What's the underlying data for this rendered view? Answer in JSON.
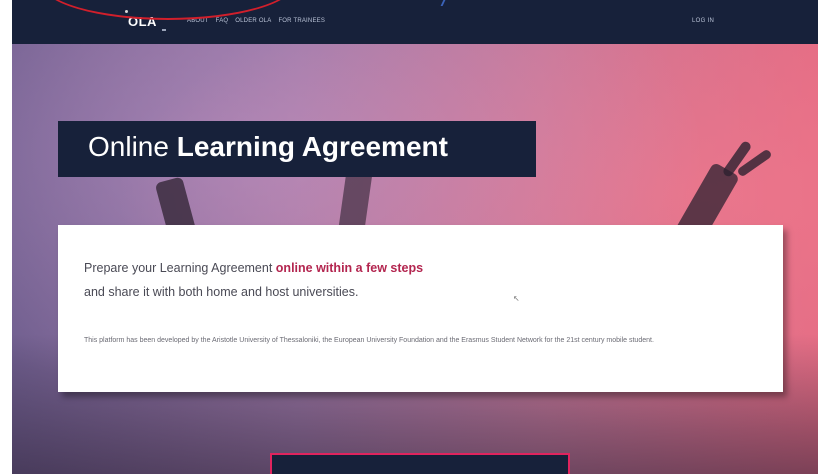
{
  "navbar": {
    "logo": "OLA",
    "links": [
      "ABOUT",
      "FAQ",
      "OLDER OLA",
      "FOR TRAINEES"
    ],
    "login": "LOG IN"
  },
  "hero": {
    "title_light": "Online",
    "title_bold": "Learning Agreement"
  },
  "card": {
    "lead1_prefix": "Prepare your Learning Agreement ",
    "lead1_accent": "online within a few steps",
    "lead2": "and share it with both home and host universities.",
    "fine_print": "This platform has been developed by the Aristotle University of Thessaloniki, the European University Foundation and the Erasmus Student Network for the 21st century mobile student."
  },
  "colors": {
    "navbar_bg": "#17213a",
    "accent": "#b3254f",
    "annotation_circle": "#d11f2b"
  }
}
